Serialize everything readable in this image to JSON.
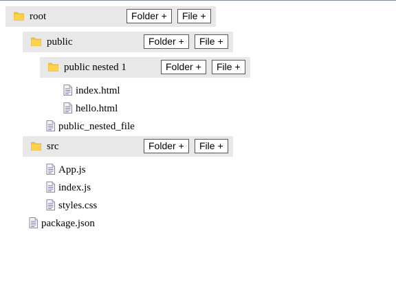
{
  "tree": {
    "root": {
      "name": "root",
      "folder_button": "Folder +",
      "file_button": "File +"
    },
    "public": {
      "name": "public",
      "folder_button": "Folder +",
      "file_button": "File +"
    },
    "public_nested_1": {
      "name": "public nested 1",
      "folder_button": "Folder +",
      "file_button": "File +"
    },
    "public_nested_1_files": [
      "index.html",
      "hello.html"
    ],
    "public_files": [
      "public_nested_file"
    ],
    "src": {
      "name": "src",
      "folder_button": "Folder +",
      "file_button": "File +"
    },
    "src_files": [
      "App.js",
      "index.js",
      "styles.css"
    ],
    "root_files": [
      "package.json"
    ]
  },
  "icons": {
    "folder": "folder-icon",
    "file": "file-icon"
  },
  "colors": {
    "folder_row_bg": "#e8e8e8",
    "folder_icon": "#f5c542",
    "page_background": "#ffffff"
  }
}
